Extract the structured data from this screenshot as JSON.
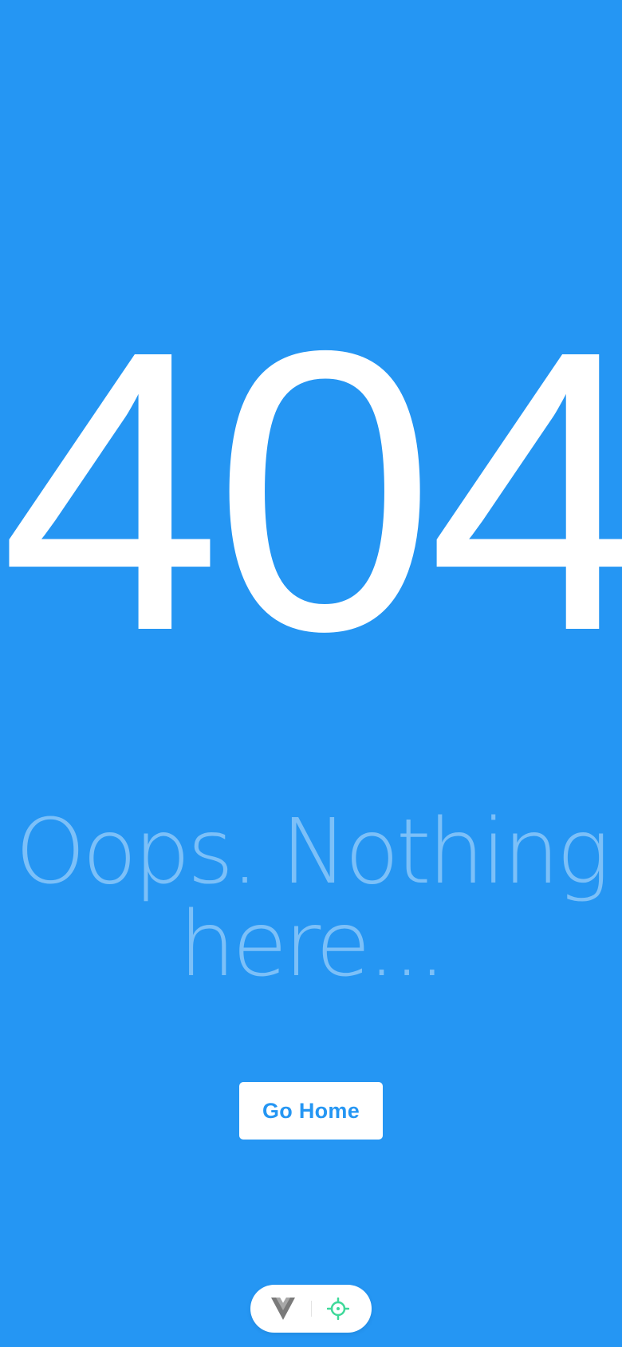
{
  "colors": {
    "background": "#2596f3",
    "code_text": "#ffffff",
    "message_text": "#7cc0f8",
    "button_background": "#ffffff",
    "button_text": "#2596f3",
    "logo_gray": "#7a7a7a",
    "target_green": "#3fd99a"
  },
  "error": {
    "code": "404",
    "message_line1": "Oops. Nothing",
    "message_line2": "here..."
  },
  "actions": {
    "go_home_label": "Go Home"
  },
  "devtools": {
    "logo_icon": "vue-devtools-logo-icon",
    "inspector_icon": "crosshair-target-icon"
  }
}
